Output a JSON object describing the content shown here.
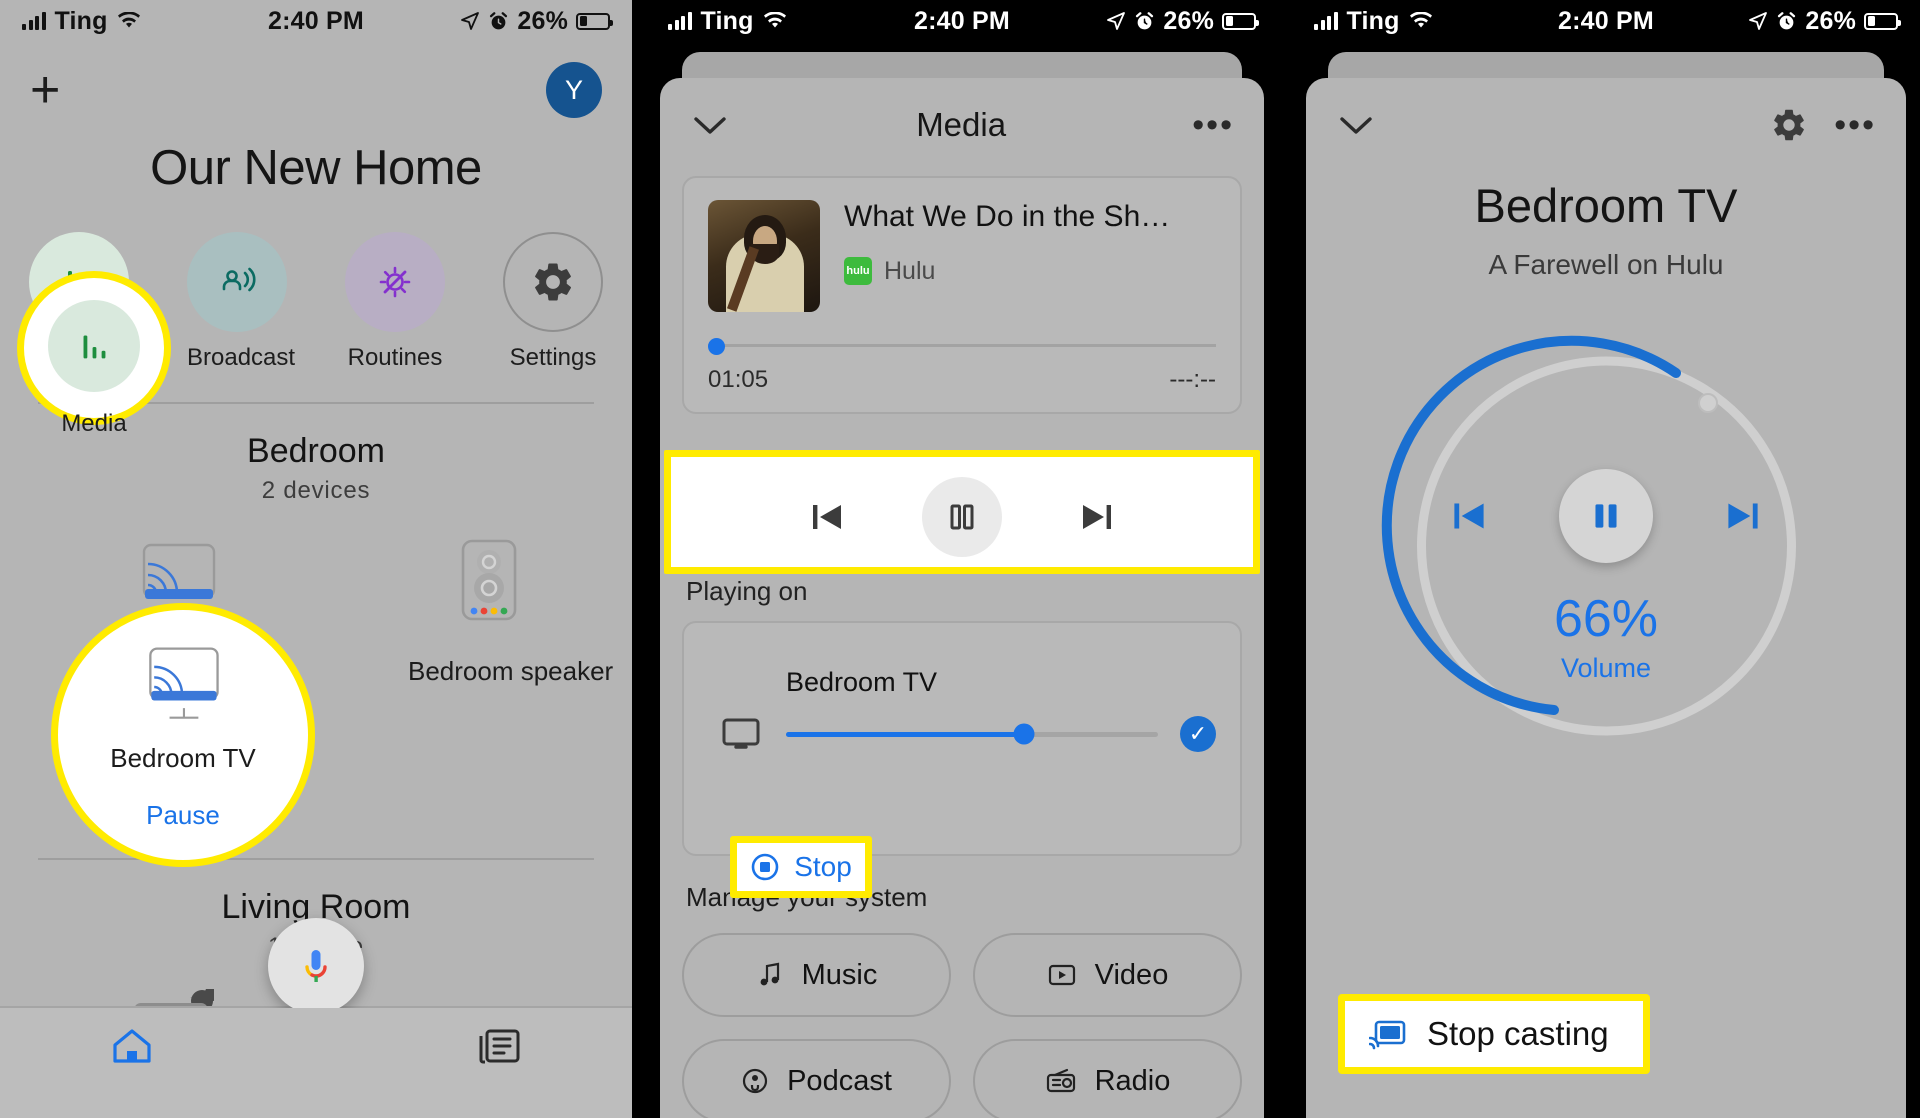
{
  "status_bar": {
    "carrier": "Ting",
    "time": "2:40 PM",
    "battery_percent": "26%",
    "signal_icon": "signal-bars-icon",
    "wifi_icon": "wifi-icon",
    "location_icon": "location-arrow-icon",
    "alarm_icon": "alarm-clock-icon",
    "battery_icon": "battery-icon"
  },
  "panel1": {
    "add_button": "+",
    "avatar_initial": "Y",
    "home_title": "Our New Home",
    "quick_actions": [
      {
        "label": "Media",
        "icon": "media-bars-icon",
        "bg": "#d9e9dd",
        "fg": "#1e8e3e",
        "highlighted": true
      },
      {
        "label": "Broadcast",
        "icon": "broadcast-icon",
        "bg": "#a9bfc0",
        "fg": "#0b6b62",
        "highlighted": false
      },
      {
        "label": "Routines",
        "icon": "routines-sun-icon",
        "bg": "#b8aec4",
        "fg": "#8430ce",
        "highlighted": false
      },
      {
        "label": "Settings",
        "icon": "gear-icon",
        "bg": "#b5b5b5",
        "fg": "#3c3c3c",
        "highlighted": false
      }
    ],
    "rooms": [
      {
        "name": "Bedroom",
        "device_count": "2 devices",
        "devices": [
          {
            "name": "Bedroom TV",
            "state": "Pause",
            "icon": "chromecast-tv-icon",
            "highlighted": true
          },
          {
            "name": "Bedroom speaker",
            "state": "",
            "icon": "google-speaker-icon",
            "highlighted": false
          }
        ]
      },
      {
        "name": "Living Room",
        "device_count": "1 device",
        "devices": [
          {
            "name": "",
            "state": "",
            "icon": "camera-icon",
            "highlighted": false
          }
        ]
      }
    ],
    "nav": [
      {
        "name": "home-tab",
        "icon": "home-icon",
        "active": true
      },
      {
        "name": "feed-tab",
        "icon": "feed-icon",
        "active": false
      }
    ],
    "assistant_button_icon": "google-assistant-mic-icon"
  },
  "panel2": {
    "collapse_icon": "chevron-down-icon",
    "title": "Media",
    "overflow_icon": "more-horizontal-icon",
    "now_playing": {
      "title": "What We Do in the Shado...",
      "source": "Hulu",
      "source_badge": "hulu",
      "elapsed": "01:05",
      "remaining": "---:--",
      "progress_percent": 3
    },
    "transport": {
      "previous_icon": "skip-previous-icon",
      "play_pause_icon": "pause-icon",
      "next_icon": "skip-next-icon",
      "highlighted": true
    },
    "playing_on": {
      "section_label": "Playing on",
      "device_name": "Bedroom TV",
      "device_icon": "tv-icon",
      "volume_percent": 64,
      "selected_icon": "check-circle-icon",
      "stop_label": "Stop",
      "stop_icon": "stop-circle-icon",
      "stop_highlighted": true
    },
    "manage": {
      "section_label": "Manage your system",
      "chips": [
        {
          "label": "Music",
          "icon": "music-note-icon"
        },
        {
          "label": "Video",
          "icon": "video-icon"
        },
        {
          "label": "Podcast",
          "icon": "podcast-icon"
        },
        {
          "label": "Radio",
          "icon": "radio-icon"
        }
      ]
    }
  },
  "panel3": {
    "collapse_icon": "chevron-down-icon",
    "settings_icon": "gear-icon",
    "overflow_icon": "more-horizontal-icon",
    "title": "Bedroom TV",
    "subtitle": "A Farewell on Hulu",
    "volume_percent_label": "66%",
    "volume_label": "Volume",
    "volume_value": 66,
    "transport": {
      "previous_icon": "skip-previous-icon",
      "play_pause_icon": "pause-icon",
      "next_icon": "skip-next-icon"
    },
    "stop_casting": {
      "label": "Stop casting",
      "icon": "cast-connected-icon",
      "highlighted": true
    }
  },
  "theme": {
    "accent_blue": "#1a73e8",
    "highlight_yellow": "#ffeb00",
    "panel_bg": "#b5b5b5"
  }
}
